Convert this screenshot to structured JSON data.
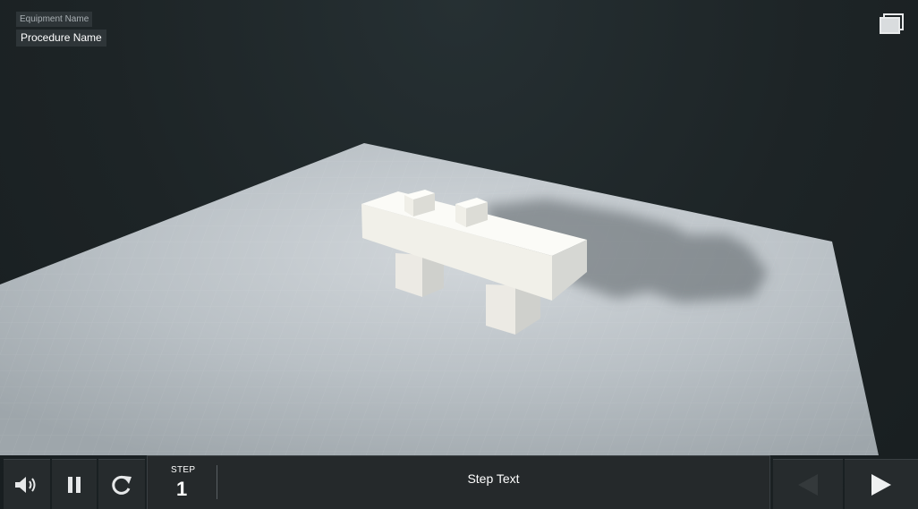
{
  "header": {
    "equipment_name": "Equipment Name",
    "procedure_name": "Procedure Name"
  },
  "window_button": {
    "icon": "window-restore-icon"
  },
  "toolbar": {
    "audio_icon": "speaker-icon",
    "pause_icon": "pause-icon",
    "restart_icon": "restart-icon",
    "step_label": "STEP",
    "step_number": "1",
    "step_text": "Step Text",
    "prev_icon": "prev-arrow-icon",
    "next_icon": "next-arrow-icon"
  },
  "colors": {
    "background": "#1c2224",
    "toolbar": "#262b2d",
    "floor": "#b8bfc4",
    "model": "#f4f4f2"
  }
}
